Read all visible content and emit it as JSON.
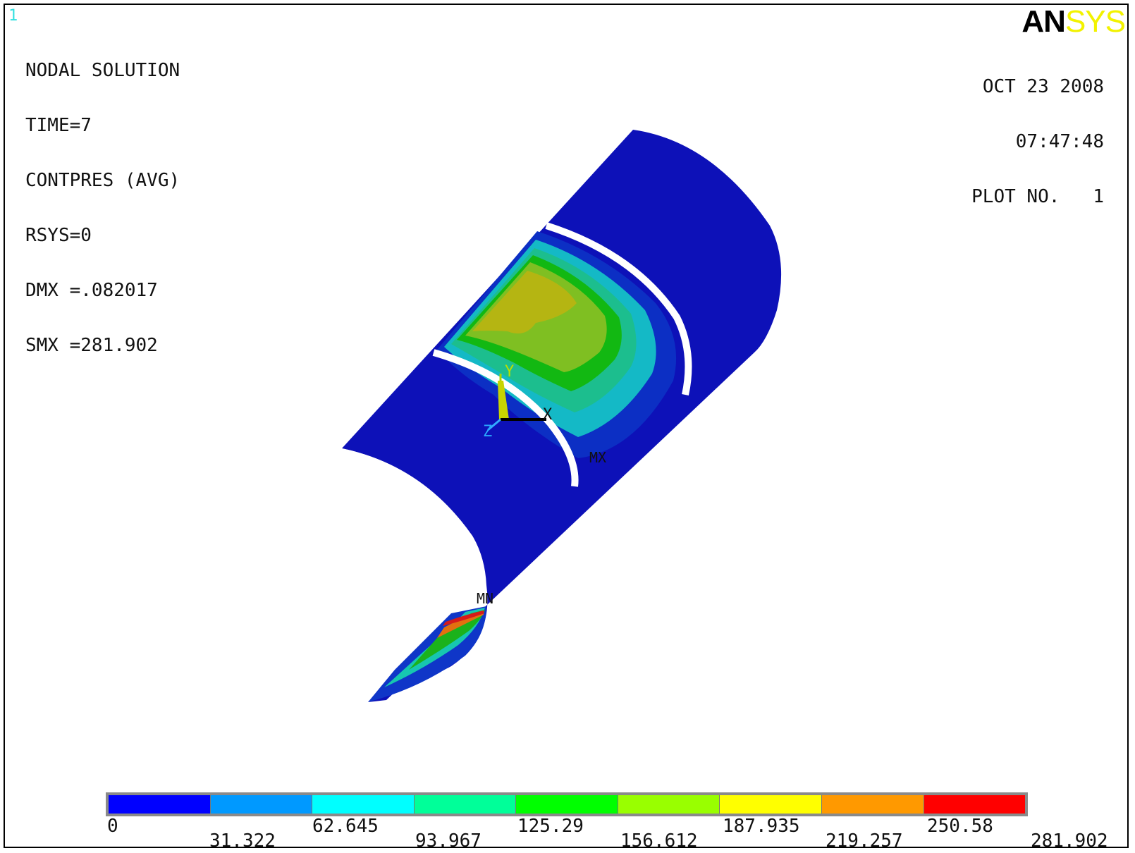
{
  "window_number": "1",
  "info": {
    "line1": "NODAL SOLUTION",
    "line2": "TIME=7",
    "line3": "CONTPRES (AVG)",
    "line4": "RSYS=0",
    "line5": "DMX =.082017",
    "line6": "SMX =281.902"
  },
  "logo": {
    "part1": "AN",
    "part2": "SYS"
  },
  "stamp": {
    "date": "OCT 23 2008",
    "time": "07:47:48",
    "plot": "PLOT NO.   1"
  },
  "markers": {
    "max": "MX",
    "min": "MN"
  },
  "triad": {
    "x": "X",
    "y": "Y",
    "z": "Z"
  },
  "legend": {
    "colors": [
      "#0000ff",
      "#0099ff",
      "#00ffff",
      "#00ff99",
      "#00ff00",
      "#99ff00",
      "#ffff00",
      "#ff9900",
      "#ff0000"
    ],
    "top_labels": [
      "0",
      "62.645",
      "125.29",
      "187.935",
      "250.58"
    ],
    "bottom_labels": [
      "31.322",
      "93.967",
      "156.612",
      "219.257",
      "281.902"
    ]
  }
}
